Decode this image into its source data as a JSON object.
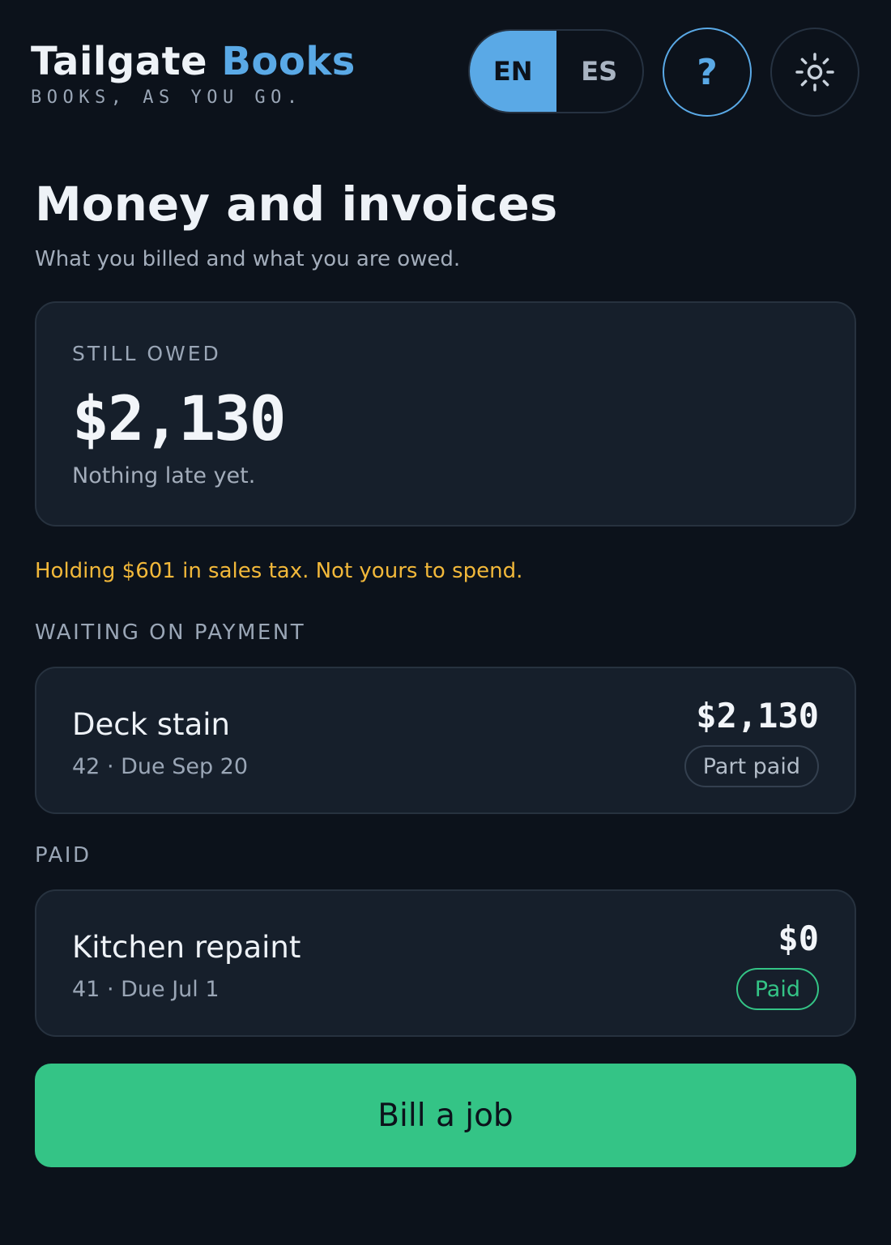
{
  "brand": {
    "title_part1": "Tailgate",
    "title_part2": "Books",
    "tagline": "BOOKS, AS YOU GO."
  },
  "header": {
    "language_options": [
      {
        "label": "EN",
        "active": true
      },
      {
        "label": "ES",
        "active": false
      }
    ],
    "help_label": "?",
    "settings_icon": "gear-icon"
  },
  "page": {
    "title": "Money and invoices",
    "subtitle": "What you billed and what you are owed."
  },
  "summary": {
    "label": "STILL OWED",
    "amount": "$2,130",
    "note": "Nothing late yet."
  },
  "tax_note": "Holding $601 in sales tax. Not yours to spend.",
  "sections": {
    "waiting": {
      "label": "WAITING ON PAYMENT",
      "invoices": [
        {
          "name": "Deck stain",
          "meta": "42 · Due Sep 20",
          "amount": "$2,130",
          "status": "Part paid"
        }
      ]
    },
    "paid": {
      "label": "PAID",
      "invoices": [
        {
          "name": "Kitchen repaint",
          "meta": "41 · Due Jul 1",
          "amount": "$0",
          "status": "Paid"
        }
      ]
    }
  },
  "cta": {
    "label": "Bill a job"
  },
  "colors": {
    "background": "#0c121b",
    "accent_blue": "#5aa9e6",
    "accent_green": "#34c486",
    "warning_yellow": "#f2b83a",
    "card": "#161f2b"
  }
}
